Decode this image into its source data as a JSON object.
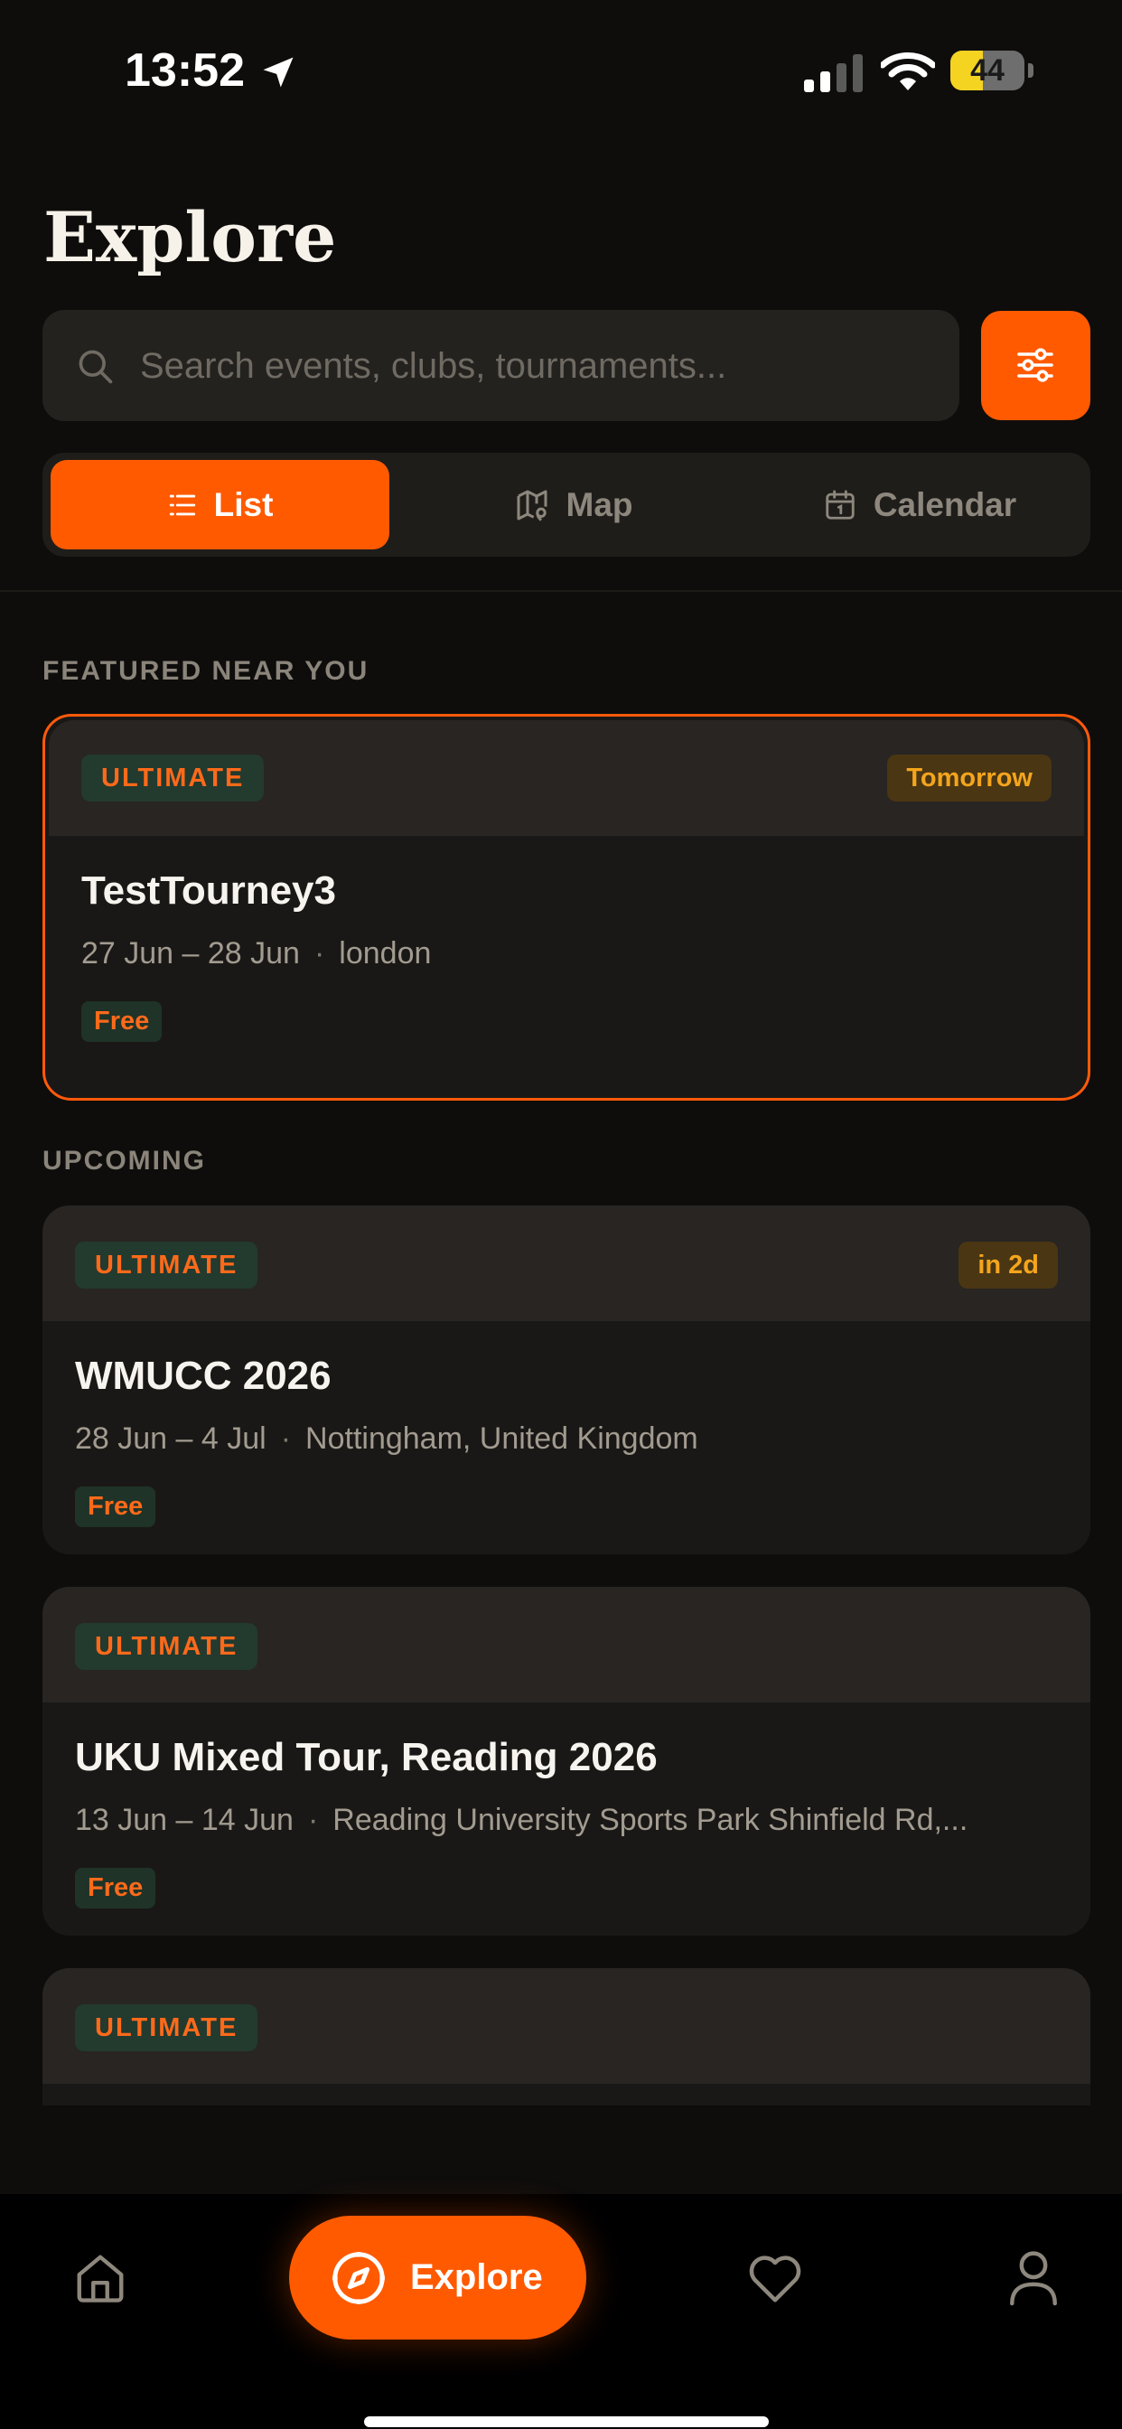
{
  "status_bar": {
    "time": "13:52",
    "battery": "44",
    "battery_level": 0.44
  },
  "header": {
    "title": "Explore"
  },
  "search": {
    "placeholder": "Search events, clubs, tournaments..."
  },
  "view_toggle": {
    "options": [
      {
        "label": "List",
        "icon": "list-icon",
        "active": true
      },
      {
        "label": "Map",
        "icon": "map-icon",
        "active": false
      },
      {
        "label": "Calendar",
        "icon": "calendar-icon",
        "active": false
      }
    ]
  },
  "sections": {
    "featured": {
      "label": "FEATURED NEAR YOU",
      "events": [
        {
          "sport": "ULTIMATE",
          "when": "Tomorrow",
          "title": "TestTourney3",
          "dates": "27 Jun – 28 Jun",
          "location": "london",
          "price": "Free"
        }
      ]
    },
    "upcoming": {
      "label": "UPCOMING",
      "events": [
        {
          "sport": "ULTIMATE",
          "when": "in 2d",
          "title": "WMUCC 2026",
          "dates": "28 Jun – 4 Jul",
          "location": "Nottingham, United Kingdom",
          "price": "Free"
        },
        {
          "sport": "ULTIMATE",
          "title": "UKU Mixed Tour, Reading 2026",
          "dates": "13 Jun – 14 Jun",
          "location": "Reading University Sports Park Shinfield Rd,...",
          "price": "Free"
        },
        {
          "sport": "ULTIMATE"
        }
      ]
    }
  },
  "tab_bar": {
    "items": [
      {
        "icon": "home-icon"
      },
      {
        "icon": "compass-icon",
        "label": "Explore",
        "active": true
      },
      {
        "icon": "heart-icon"
      },
      {
        "icon": "user-icon"
      }
    ]
  },
  "colors": {
    "accent": "#ff5a00",
    "background": "#0e0d0c",
    "sport_tag_bg": "#233a2f",
    "when_tag_bg": "#4a3613",
    "when_tag_text": "#f4a51c"
  }
}
